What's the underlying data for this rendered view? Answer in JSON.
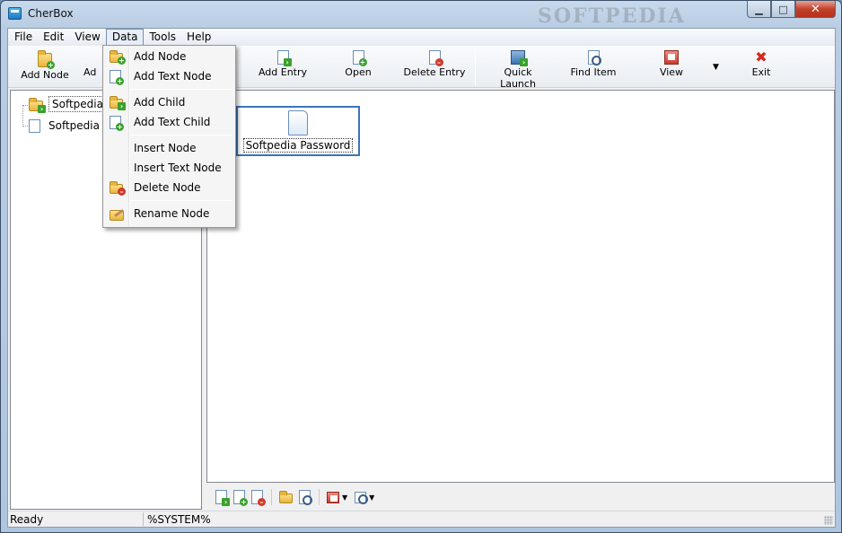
{
  "window": {
    "title": "CherBox",
    "watermark": "SOFTPEDIA",
    "caption": {
      "minimize": "▁",
      "maximize": "□",
      "close": "✕"
    }
  },
  "menubar": {
    "items": [
      {
        "label": "File"
      },
      {
        "label": "Edit"
      },
      {
        "label": "View"
      },
      {
        "label": "Data"
      },
      {
        "label": "Tools"
      },
      {
        "label": "Help"
      }
    ]
  },
  "toolbar": {
    "add_node": "Add Node",
    "add_partial": "Ad",
    "add_entry": "Add Entry",
    "open": "Open",
    "delete_entry": "Delete Entry",
    "quick_launch": "Quick Launch",
    "find_item": "Find Item",
    "view": "View",
    "exit": "Exit",
    "dropdown_arrow": "▼"
  },
  "data_menu": {
    "items": [
      {
        "label": "Add Node",
        "icon": "folder-add-icon"
      },
      {
        "label": "Add Text Node",
        "icon": "page-add-icon"
      },
      {
        "label": "Add Child",
        "icon": "folder-child-icon"
      },
      {
        "label": "Add Text Child",
        "icon": "page-child-icon"
      },
      {
        "label": "Insert Node",
        "icon": ""
      },
      {
        "label": "Insert Text Node",
        "icon": ""
      },
      {
        "label": "Delete Node",
        "icon": "folder-delete-icon"
      },
      {
        "label": "Rename Node",
        "icon": "rename-icon"
      }
    ]
  },
  "tree": {
    "nodes": [
      {
        "label": "Softpedia",
        "type": "folder",
        "selected": true
      },
      {
        "label": "Softpedia",
        "type": "text"
      }
    ]
  },
  "entries": [
    {
      "name": "Softpedia Password"
    }
  ],
  "bottom_toolbar": {
    "arrow": "▼"
  },
  "status": {
    "state": "Ready",
    "user": "%SYSTEM%"
  },
  "colors": {
    "selection_border": "#3b76b9",
    "title_gradient": "#b9cde3",
    "delete_red": "#d23a2a",
    "add_green": "#3aa12c"
  }
}
